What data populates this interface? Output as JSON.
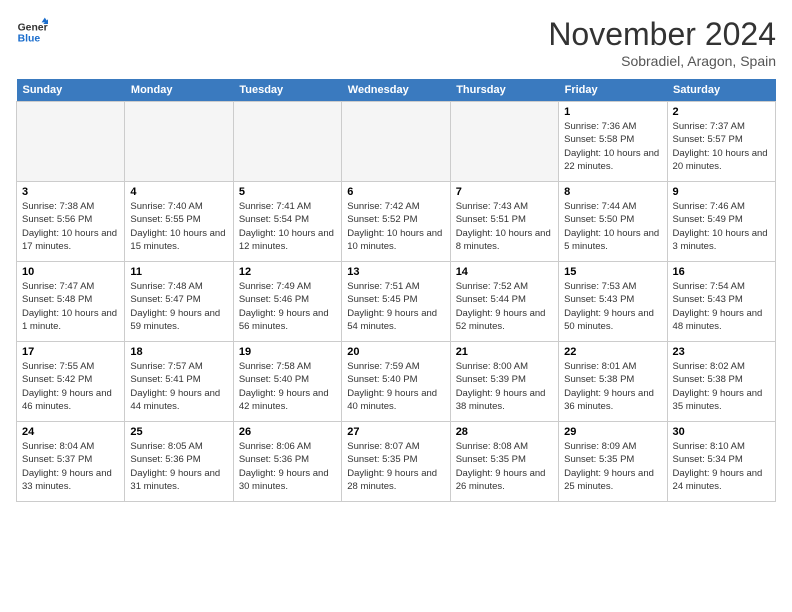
{
  "header": {
    "logo_line1": "General",
    "logo_line2": "Blue",
    "month_title": "November 2024",
    "subtitle": "Sobradiel, Aragon, Spain"
  },
  "weekdays": [
    "Sunday",
    "Monday",
    "Tuesday",
    "Wednesday",
    "Thursday",
    "Friday",
    "Saturday"
  ],
  "weeks": [
    [
      {
        "day": "",
        "empty": true
      },
      {
        "day": "",
        "empty": true
      },
      {
        "day": "",
        "empty": true
      },
      {
        "day": "",
        "empty": true
      },
      {
        "day": "",
        "empty": true
      },
      {
        "day": "1",
        "sunrise": "7:36 AM",
        "sunset": "5:58 PM",
        "daylight": "10 hours and 22 minutes."
      },
      {
        "day": "2",
        "sunrise": "7:37 AM",
        "sunset": "5:57 PM",
        "daylight": "10 hours and 20 minutes."
      }
    ],
    [
      {
        "day": "3",
        "sunrise": "7:38 AM",
        "sunset": "5:56 PM",
        "daylight": "10 hours and 17 minutes."
      },
      {
        "day": "4",
        "sunrise": "7:40 AM",
        "sunset": "5:55 PM",
        "daylight": "10 hours and 15 minutes."
      },
      {
        "day": "5",
        "sunrise": "7:41 AM",
        "sunset": "5:54 PM",
        "daylight": "10 hours and 12 minutes."
      },
      {
        "day": "6",
        "sunrise": "7:42 AM",
        "sunset": "5:52 PM",
        "daylight": "10 hours and 10 minutes."
      },
      {
        "day": "7",
        "sunrise": "7:43 AM",
        "sunset": "5:51 PM",
        "daylight": "10 hours and 8 minutes."
      },
      {
        "day": "8",
        "sunrise": "7:44 AM",
        "sunset": "5:50 PM",
        "daylight": "10 hours and 5 minutes."
      },
      {
        "day": "9",
        "sunrise": "7:46 AM",
        "sunset": "5:49 PM",
        "daylight": "10 hours and 3 minutes."
      }
    ],
    [
      {
        "day": "10",
        "sunrise": "7:47 AM",
        "sunset": "5:48 PM",
        "daylight": "10 hours and 1 minute."
      },
      {
        "day": "11",
        "sunrise": "7:48 AM",
        "sunset": "5:47 PM",
        "daylight": "9 hours and 59 minutes."
      },
      {
        "day": "12",
        "sunrise": "7:49 AM",
        "sunset": "5:46 PM",
        "daylight": "9 hours and 56 minutes."
      },
      {
        "day": "13",
        "sunrise": "7:51 AM",
        "sunset": "5:45 PM",
        "daylight": "9 hours and 54 minutes."
      },
      {
        "day": "14",
        "sunrise": "7:52 AM",
        "sunset": "5:44 PM",
        "daylight": "9 hours and 52 minutes."
      },
      {
        "day": "15",
        "sunrise": "7:53 AM",
        "sunset": "5:43 PM",
        "daylight": "9 hours and 50 minutes."
      },
      {
        "day": "16",
        "sunrise": "7:54 AM",
        "sunset": "5:43 PM",
        "daylight": "9 hours and 48 minutes."
      }
    ],
    [
      {
        "day": "17",
        "sunrise": "7:55 AM",
        "sunset": "5:42 PM",
        "daylight": "9 hours and 46 minutes."
      },
      {
        "day": "18",
        "sunrise": "7:57 AM",
        "sunset": "5:41 PM",
        "daylight": "9 hours and 44 minutes."
      },
      {
        "day": "19",
        "sunrise": "7:58 AM",
        "sunset": "5:40 PM",
        "daylight": "9 hours and 42 minutes."
      },
      {
        "day": "20",
        "sunrise": "7:59 AM",
        "sunset": "5:40 PM",
        "daylight": "9 hours and 40 minutes."
      },
      {
        "day": "21",
        "sunrise": "8:00 AM",
        "sunset": "5:39 PM",
        "daylight": "9 hours and 38 minutes."
      },
      {
        "day": "22",
        "sunrise": "8:01 AM",
        "sunset": "5:38 PM",
        "daylight": "9 hours and 36 minutes."
      },
      {
        "day": "23",
        "sunrise": "8:02 AM",
        "sunset": "5:38 PM",
        "daylight": "9 hours and 35 minutes."
      }
    ],
    [
      {
        "day": "24",
        "sunrise": "8:04 AM",
        "sunset": "5:37 PM",
        "daylight": "9 hours and 33 minutes."
      },
      {
        "day": "25",
        "sunrise": "8:05 AM",
        "sunset": "5:36 PM",
        "daylight": "9 hours and 31 minutes."
      },
      {
        "day": "26",
        "sunrise": "8:06 AM",
        "sunset": "5:36 PM",
        "daylight": "9 hours and 30 minutes."
      },
      {
        "day": "27",
        "sunrise": "8:07 AM",
        "sunset": "5:35 PM",
        "daylight": "9 hours and 28 minutes."
      },
      {
        "day": "28",
        "sunrise": "8:08 AM",
        "sunset": "5:35 PM",
        "daylight": "9 hours and 26 minutes."
      },
      {
        "day": "29",
        "sunrise": "8:09 AM",
        "sunset": "5:35 PM",
        "daylight": "9 hours and 25 minutes."
      },
      {
        "day": "30",
        "sunrise": "8:10 AM",
        "sunset": "5:34 PM",
        "daylight": "9 hours and 24 minutes."
      }
    ]
  ]
}
